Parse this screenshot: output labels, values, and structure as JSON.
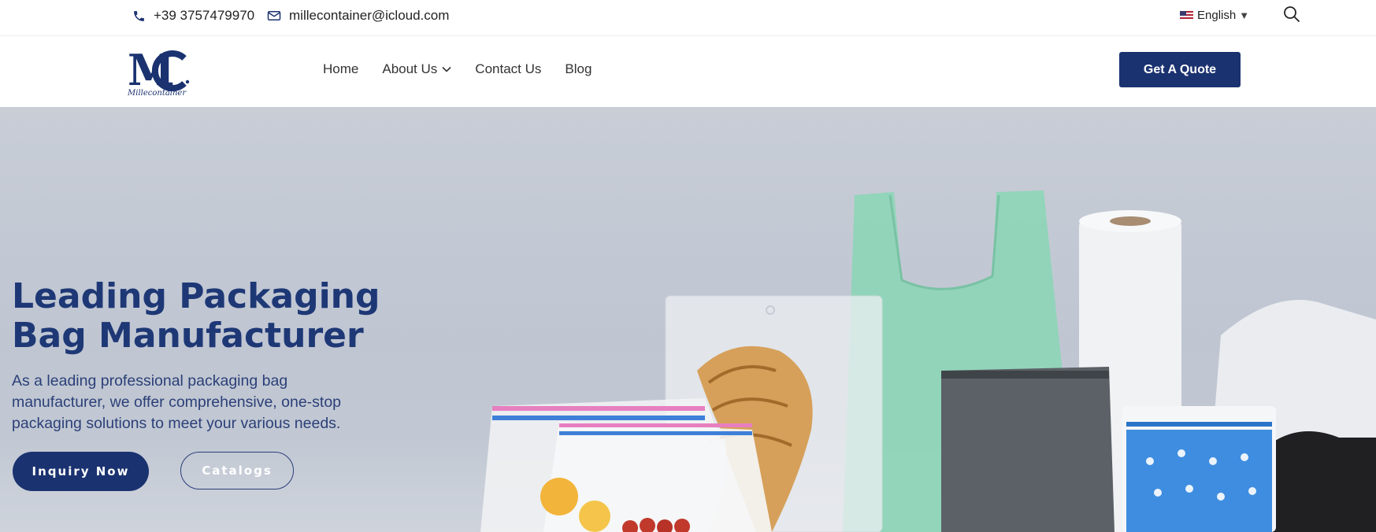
{
  "topbar": {
    "phone": "+39 3757479970",
    "email": "millecontainer@icloud.com",
    "language": "English",
    "language_arrow": "▼"
  },
  "header": {
    "logo_text": "Millecontainer",
    "nav": [
      {
        "label": "Home"
      },
      {
        "label": "About Us"
      },
      {
        "label": "Contact Us"
      },
      {
        "label": "Blog"
      }
    ],
    "quote_button": "Get A Quote"
  },
  "hero": {
    "title_line1": "Leading Packaging",
    "title_line2": "Bag Manufacturer",
    "description": "As a leading professional packaging bag manufacturer, we offer comprehensive, one-stop packaging solutions to meet your various needs.",
    "primary_button": "Inquiry Now",
    "secondary_button": "Catalogs"
  },
  "icons": {
    "phone": "phone-icon",
    "email": "envelope-icon",
    "flag": "us-flag-icon",
    "search": "search-icon",
    "chevron": "chevron-down-icon"
  },
  "colors": {
    "brand": "#1b3270",
    "title": "#1e3876",
    "hero_bg": "#c4cad4"
  }
}
